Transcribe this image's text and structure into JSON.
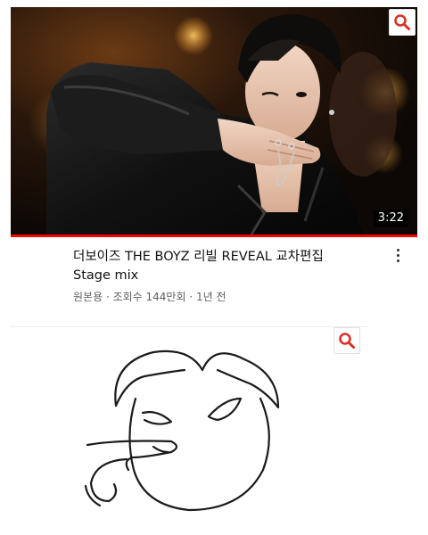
{
  "video": {
    "duration": "3:22",
    "title_line1": "더보이즈 THE BOYZ 리빌 REVEAL 교차편집",
    "title_line2": "Stage mix",
    "channel": "원본용",
    "separator": " · ",
    "views": "조회수 144만회",
    "age": "1년 전",
    "watched_fraction": 1.0
  },
  "icons": {
    "search": "search-icon",
    "more": "more-vert-icon"
  },
  "colors": {
    "accent_red": "#ff0000",
    "search_red": "#d93025",
    "text_primary": "#111111",
    "text_secondary": "#606060"
  }
}
